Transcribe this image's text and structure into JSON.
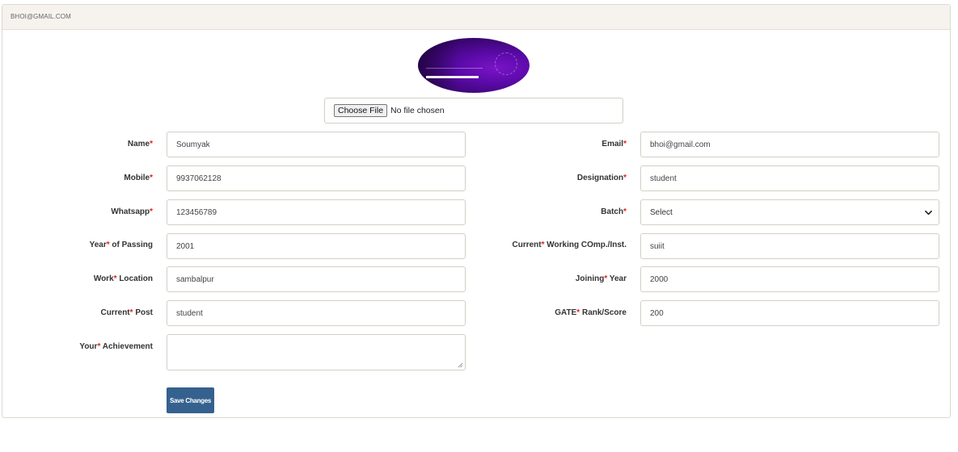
{
  "header": {
    "email_title": "BHOI@GMAIL.COM"
  },
  "profile": {
    "avatar_icon": "profile-photo",
    "file_button": "Choose File",
    "file_status": "No file chosen"
  },
  "form": {
    "name": {
      "label": "Name",
      "value": "Soumyak"
    },
    "email": {
      "label": "Email",
      "value": "bhoi@gmail.com"
    },
    "mobile": {
      "label": "Mobile",
      "value": "9937062128"
    },
    "designation": {
      "label": "Designation",
      "value": "student"
    },
    "whatsapp": {
      "label": "Whatsapp",
      "value": "123456789"
    },
    "batch": {
      "label": "Batch",
      "value": "Select"
    },
    "year_passing": {
      "label_a": "Year",
      "label_b": " of Passing",
      "value": "2001"
    },
    "current_company": {
      "label_a": "Current",
      "label_b": " Working COmp./Inst.",
      "value": "suiit"
    },
    "work_location": {
      "label_a": "Work",
      "label_b": " Location",
      "value": "sambalpur"
    },
    "joining_year": {
      "label_a": "Joining",
      "label_b": " Year",
      "value": "2000"
    },
    "current_post": {
      "label_a": "Current",
      "label_b": " Post",
      "value": "student"
    },
    "gate_rank": {
      "label_a": "GATE",
      "label_b": " Rank/Score",
      "value": "200"
    },
    "achievement": {
      "label_a": "Your",
      "label_b": " Achievement",
      "value": ""
    },
    "required_mark": "*"
  },
  "actions": {
    "save_label": "Save Changes"
  },
  "colors": {
    "primary_button": "#35618f",
    "required": "#e02020",
    "header_bg": "#f6f3ee"
  }
}
